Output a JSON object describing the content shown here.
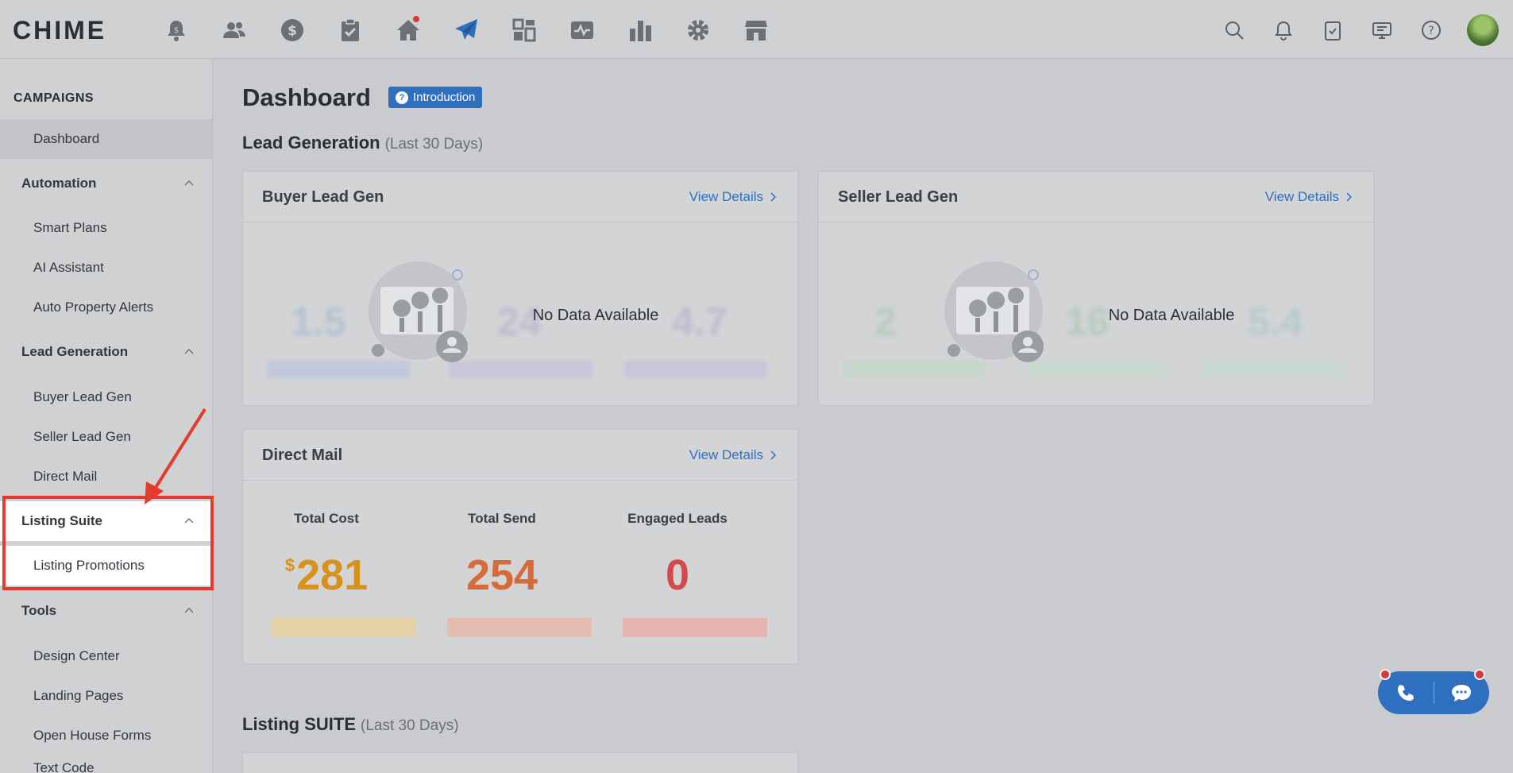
{
  "app": {
    "logo": "CHIME"
  },
  "topnav": {
    "icons": [
      "alert-bell-dollar-icon",
      "people-icon",
      "dollar-icon",
      "clipboard-check-icon",
      "home-icon",
      "paper-plane-icon",
      "dashboard-tiles-icon",
      "activity-icon",
      "bar-chart-icon",
      "gear-icon",
      "storefront-icon"
    ],
    "right_icons": [
      "search-icon",
      "bell-icon",
      "task-clipboard-icon",
      "presentation-icon",
      "help-icon"
    ]
  },
  "sidebar": {
    "heading": "CAMPAIGNS",
    "dashboard": "Dashboard",
    "groups": [
      {
        "label": "Automation",
        "items": [
          "Smart Plans",
          "AI Assistant",
          "Auto Property Alerts"
        ]
      },
      {
        "label": "Lead Generation",
        "items": [
          "Buyer Lead Gen",
          "Seller Lead Gen",
          "Direct Mail"
        ]
      },
      {
        "label": "Listing Suite",
        "items": [
          "Listing Promotions"
        ]
      },
      {
        "label": "Tools",
        "items": [
          "Design Center",
          "Landing Pages",
          "Open House Forms",
          "Text Code"
        ]
      }
    ]
  },
  "main": {
    "title": "Dashboard",
    "intro_badge": "Introduction",
    "lead_gen_section": {
      "title": "Lead Generation",
      "sub": "(Last 30 Days)"
    },
    "buyer_card": {
      "title": "Buyer Lead Gen",
      "view": "View Details",
      "no_data": "No Data Available"
    },
    "seller_card": {
      "title": "Seller Lead Gen",
      "view": "View Details",
      "no_data": "No Data Available"
    },
    "direct_mail": {
      "title": "Direct Mail",
      "view": "View Details",
      "stats": [
        {
          "label": "Total Cost",
          "prefix": "$",
          "value": "281",
          "color": "#d8921a"
        },
        {
          "label": "Total Send",
          "value": "254",
          "color": "#d86a3a"
        },
        {
          "label": "Engaged Leads",
          "value": "0",
          "color": "#d24a4a"
        }
      ]
    },
    "listing_section": {
      "title": "Listing SUITE",
      "sub": "(Last 30 Days)"
    }
  },
  "colors": {
    "accent": "#2f6fc0",
    "highlight_box": "#e63a2e"
  }
}
